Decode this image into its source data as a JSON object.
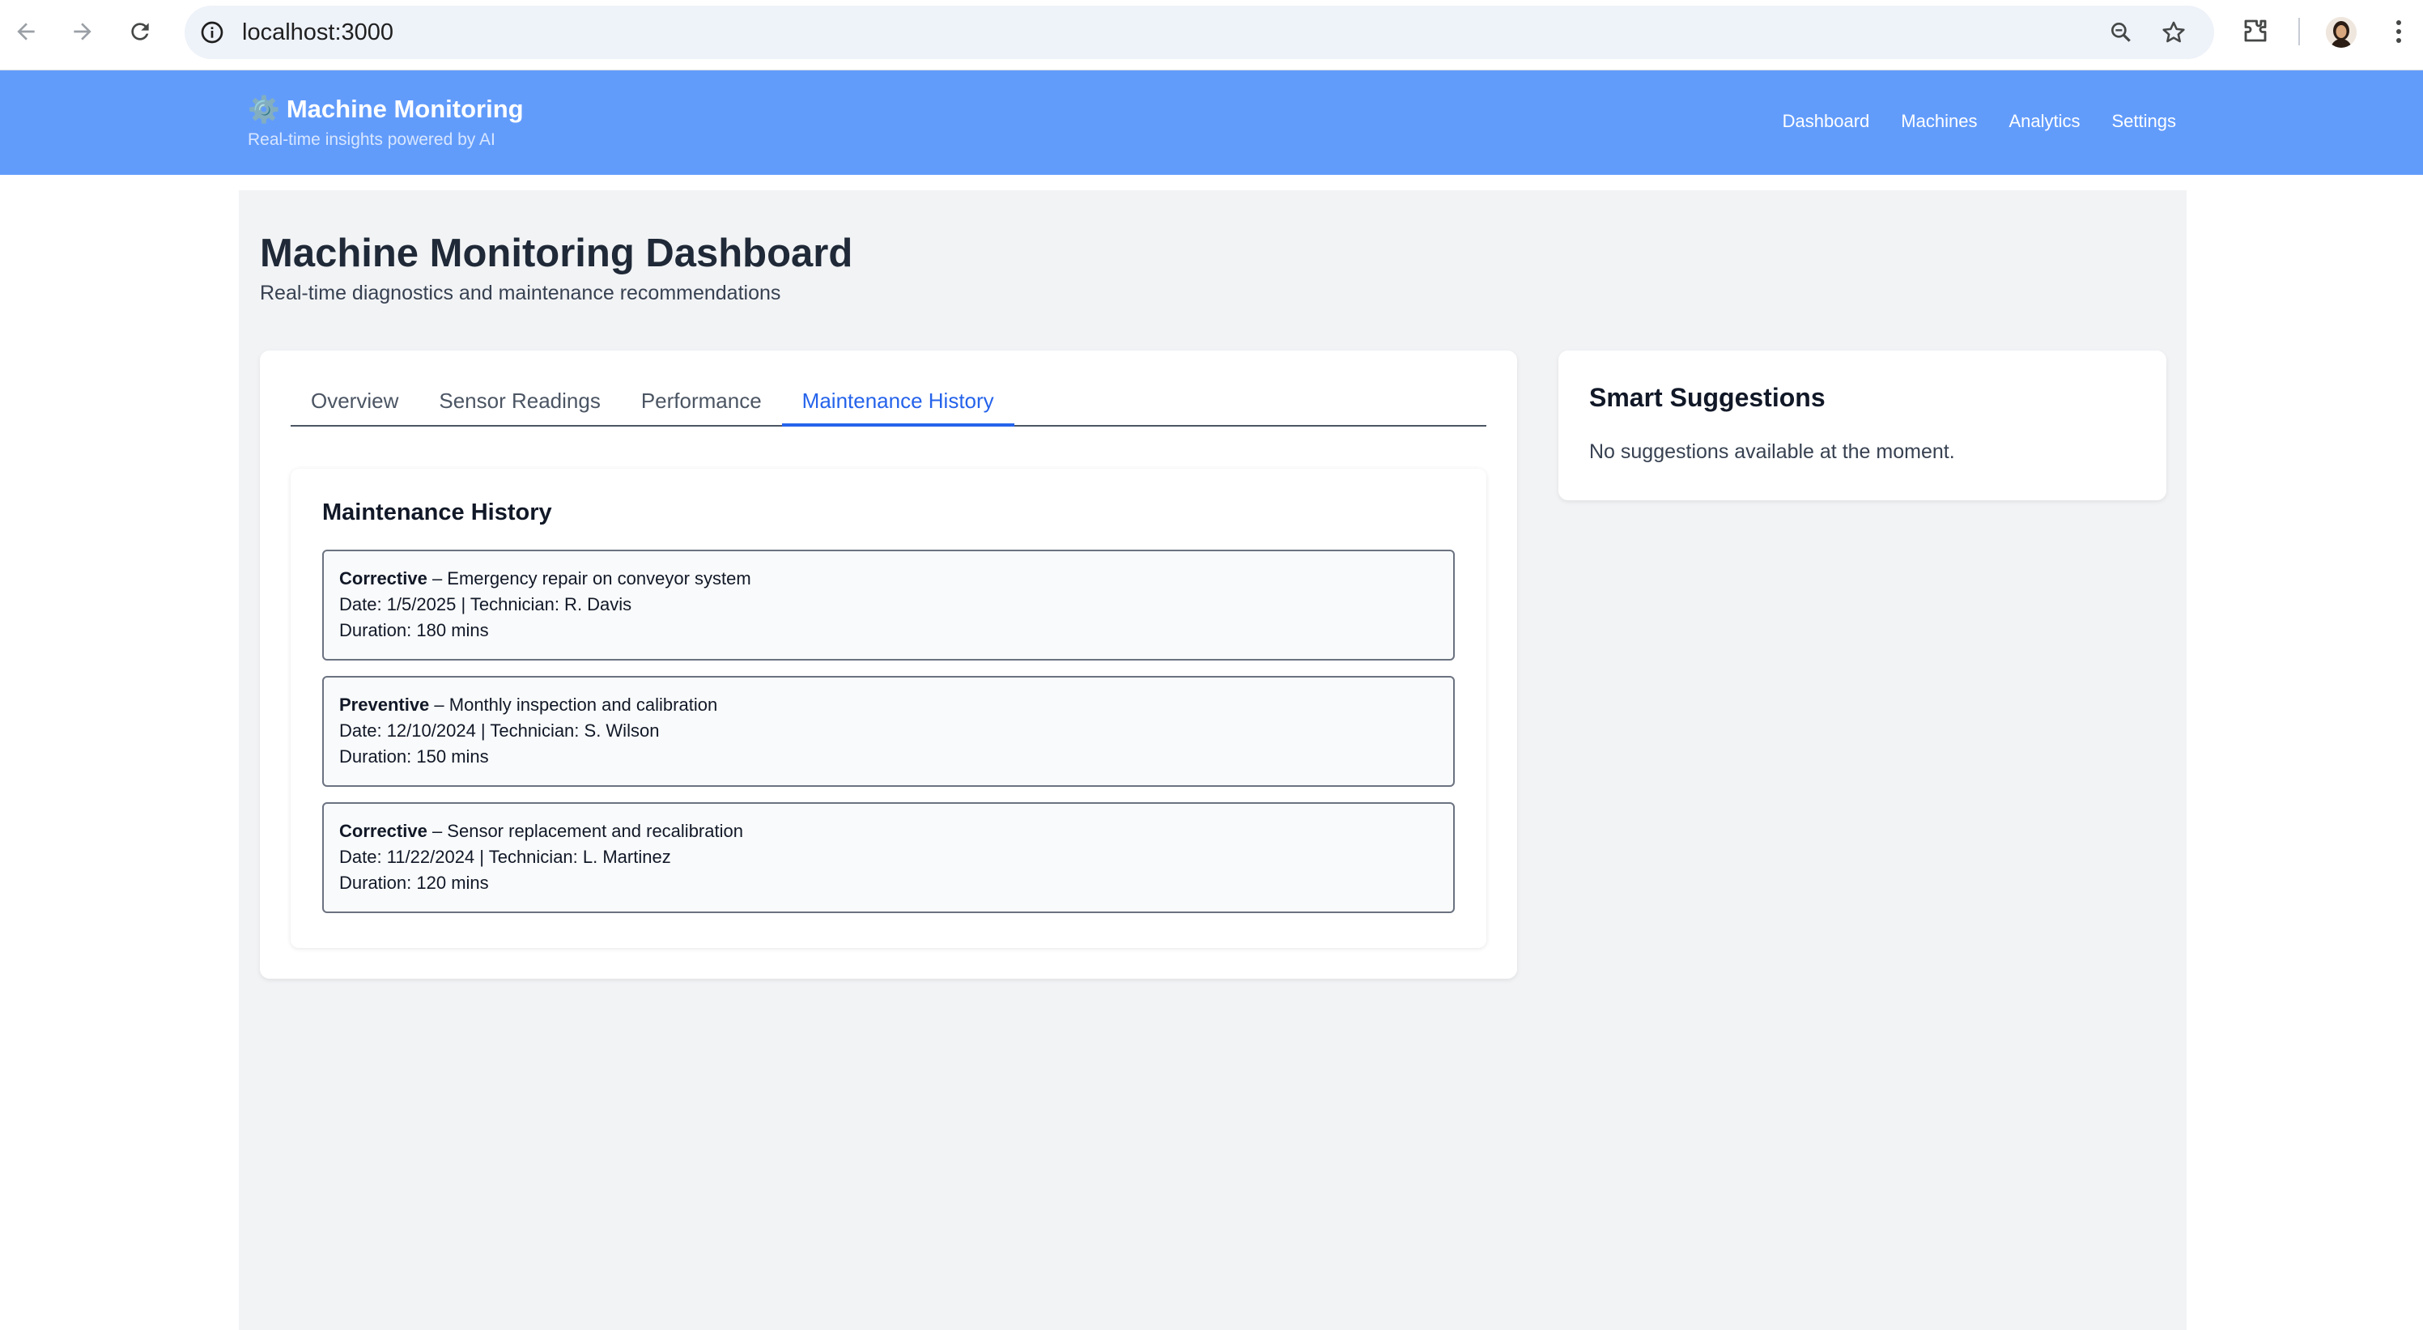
{
  "browser": {
    "url": "localhost:3000"
  },
  "header": {
    "brand_icon": "⚙️",
    "brand_title": "Machine Monitoring",
    "tagline": "Real-time insights powered by AI",
    "nav": [
      "Dashboard",
      "Machines",
      "Analytics",
      "Settings"
    ]
  },
  "page": {
    "title": "Machine Monitoring Dashboard",
    "subtitle": "Real-time diagnostics and maintenance recommendations"
  },
  "tabs": {
    "items": [
      "Overview",
      "Sensor Readings",
      "Performance",
      "Maintenance History"
    ],
    "active": "Maintenance History"
  },
  "history": {
    "title": "Maintenance History",
    "entries": [
      {
        "type": "Corrective",
        "description": " – Emergency repair on conveyor system",
        "date_line": "Date: 1/5/2025 | Technician: R. Davis",
        "duration_line": "Duration: 180 mins"
      },
      {
        "type": "Preventive",
        "description": " – Monthly inspection and calibration",
        "date_line": "Date: 12/10/2024 | Technician: S. Wilson",
        "duration_line": "Duration: 150 mins"
      },
      {
        "type": "Corrective",
        "description": " – Sensor replacement and recalibration",
        "date_line": "Date: 11/22/2024 | Technician: L. Martinez",
        "duration_line": "Duration: 120 mins"
      }
    ]
  },
  "suggestions": {
    "title": "Smart Suggestions",
    "empty_text": "No suggestions available at the moment."
  },
  "colors": {
    "header_bg": "#629cfb",
    "active_tab": "#2563eb",
    "page_bg": "#f2f3f5"
  },
  "icons": [
    "back-arrow-icon",
    "forward-arrow-icon",
    "reload-icon",
    "info-icon",
    "zoom-icon",
    "star-icon",
    "extensions-icon",
    "profile-avatar",
    "menu-dots-icon",
    "gear-icon"
  ]
}
